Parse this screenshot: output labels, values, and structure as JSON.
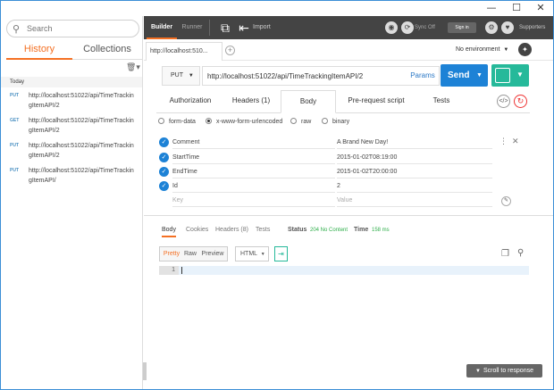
{
  "window": {
    "minimize_glyph": "—",
    "maximize_glyph": "☐",
    "close_glyph": "✕"
  },
  "sidebar": {
    "search": {
      "placeholder": "Search"
    },
    "tabs": [
      {
        "label": "History"
      },
      {
        "label": "Collections"
      }
    ],
    "day_header": "Today",
    "history": [
      {
        "method": "PUT",
        "url": "http://localhost:51022/api/TimeTrackingItemAPI/2"
      },
      {
        "method": "GET",
        "url": "http://localhost:51022/api/TimeTrackingItemAPI/2"
      },
      {
        "method": "PUT",
        "url": "http://localhost:51022/api/TimeTrackingItemAPI/2"
      },
      {
        "method": "PUT",
        "url": "http://localhost:51022/api/TimeTrackingItemAPI/"
      }
    ]
  },
  "header": {
    "tabs": [
      {
        "label": "Builder"
      },
      {
        "label": "Runner"
      }
    ],
    "import_label": "Import",
    "sync_label": "Sync Off",
    "signin_label": "Sign in",
    "supporters_label": "Supporters"
  },
  "request_tabs": {
    "tab_label": "http://localhost:510...",
    "environment": "No environment"
  },
  "request": {
    "method": "PUT",
    "url": "http://localhost:51022/api/TimeTrackingItemAPI/2",
    "params_label": "Params",
    "send_label": "Send"
  },
  "subtabs": [
    {
      "label": "Authorization"
    },
    {
      "label": "Headers (1)"
    },
    {
      "label": "Body"
    },
    {
      "label": "Pre-request script"
    },
    {
      "label": "Tests"
    }
  ],
  "body_types": [
    {
      "label": "form-data",
      "selected": false
    },
    {
      "label": "x-www-form-urlencoded",
      "selected": true
    },
    {
      "label": "raw",
      "selected": false
    },
    {
      "label": "binary",
      "selected": false
    }
  ],
  "form_rows": [
    {
      "key": "Comment",
      "value": "A Brand New Day!"
    },
    {
      "key": "StartTime",
      "value": "2015-01-02T08:19:00"
    },
    {
      "key": "EndTime",
      "value": "2015-01-02T20:00:00"
    },
    {
      "key": "Id",
      "value": "2"
    }
  ],
  "form_placeholder": {
    "key": "Key",
    "value": "Value"
  },
  "response": {
    "tabs": [
      {
        "label": "Body"
      },
      {
        "label": "Cookies"
      },
      {
        "label": "Headers (8)"
      },
      {
        "label": "Tests"
      }
    ],
    "status_label": "Status",
    "status_value": "204 No Content",
    "time_label": "Time",
    "time_value": "158 ms",
    "formats": [
      {
        "label": "Pretty"
      },
      {
        "label": "Raw"
      },
      {
        "label": "Preview"
      }
    ],
    "language": "HTML",
    "line_number": "1",
    "scroll_label": "Scroll to response"
  },
  "colors": {
    "accent": "#f47023",
    "primary": "#1d82d6",
    "save": "#26b99a",
    "header_bg": "#444444"
  }
}
